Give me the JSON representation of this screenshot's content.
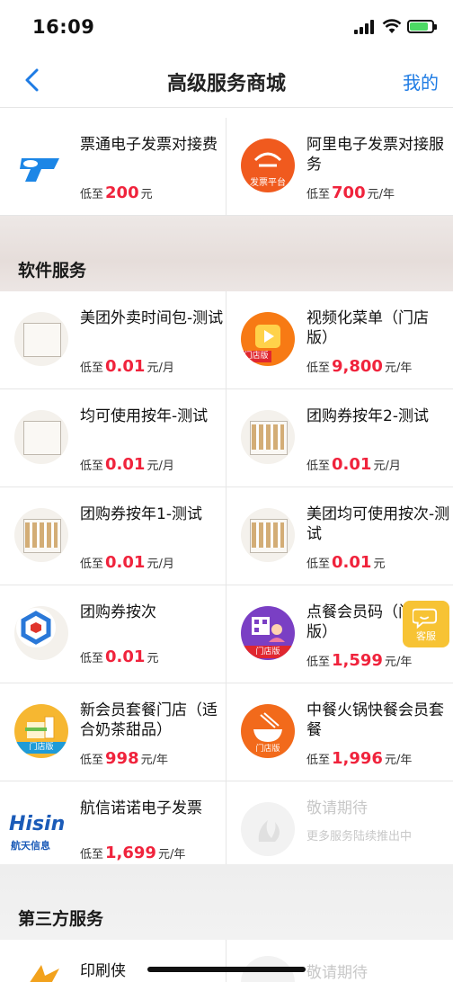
{
  "status": {
    "time": "16:09"
  },
  "nav": {
    "title": "高级服务商城",
    "mine": "我的"
  },
  "top_rows": [
    {
      "left": {
        "name": "票通电子发票对接费",
        "price_prefix": "低至",
        "price": "200",
        "unit": "元"
      },
      "right": {
        "name": "阿里电子发票对接服务",
        "price_prefix": "低至",
        "price": "700",
        "unit": "元/年",
        "icon_text": "发票平台"
      }
    }
  ],
  "section_software": {
    "label": "软件服务"
  },
  "software_rows": [
    {
      "left": {
        "name": "美团外卖时间包-测试",
        "price_prefix": "低至",
        "price": "0.01",
        "unit": "元/月"
      },
      "right": {
        "name": "视频化菜单（门店版）",
        "price_prefix": "低至",
        "price": "9,800",
        "unit": "元/年",
        "icon_text": "门店版"
      }
    },
    {
      "left": {
        "name": "均可使用按年-测试",
        "price_prefix": "低至",
        "price": "0.01",
        "unit": "元/月"
      },
      "right": {
        "name": "团购券按年2-测试",
        "price_prefix": "低至",
        "price": "0.01",
        "unit": "元/月"
      }
    },
    {
      "left": {
        "name": "团购券按年1-测试",
        "price_prefix": "低至",
        "price": "0.01",
        "unit": "元/月"
      },
      "right": {
        "name": "美团均可使用按次-测试",
        "price_prefix": "低至",
        "price": "0.01",
        "unit": "元"
      }
    },
    {
      "left": {
        "name": "团购券按次",
        "price_prefix": "低至",
        "price": "0.01",
        "unit": "元"
      },
      "right": {
        "name": "点餐会员码（门店版）",
        "price_prefix": "低至",
        "price": "1,599",
        "unit": "元/年",
        "icon_text": "门店版"
      }
    },
    {
      "left": {
        "name": "新会员套餐门店（适合奶茶甜品）",
        "price_prefix": "低至",
        "price": "998",
        "unit": "元/年",
        "icon_text": "门店版"
      },
      "right": {
        "name": "中餐火锅快餐会员套餐",
        "price_prefix": "低至",
        "price": "1,996",
        "unit": "元/年",
        "icon_text": "门店版"
      }
    },
    {
      "left": {
        "name": "航信诺诺电子发票",
        "price_prefix": "低至",
        "price": "1,699",
        "unit": "元/年",
        "logo_top": "Hisin",
        "logo_bottom": "航天信息"
      },
      "right": {
        "name": "敬请期待",
        "subtitle": "更多服务陆续推出中"
      }
    }
  ],
  "section_third": {
    "label": "第三方服务"
  },
  "third_rows": [
    {
      "left": {
        "name": "印刷侠"
      },
      "right": {
        "name": "敬请期待"
      }
    }
  ],
  "kefu": {
    "label": "客服"
  },
  "colors": {
    "accent": "#1d7be4",
    "price": "#f0233c",
    "kefu": "#f7c334"
  }
}
